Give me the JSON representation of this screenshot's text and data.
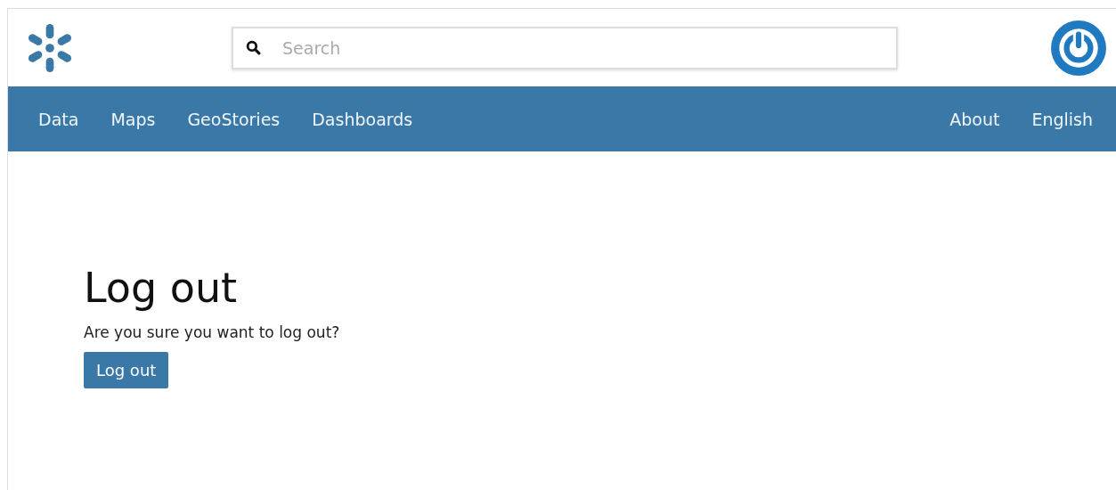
{
  "search": {
    "placeholder": "Search"
  },
  "nav": {
    "left": [
      "Data",
      "Maps",
      "GeoStories",
      "Dashboards"
    ],
    "right": [
      "About",
      "English"
    ]
  },
  "logout": {
    "title": "Log out",
    "message": "Are you sure you want to log out?",
    "button": "Log out"
  }
}
